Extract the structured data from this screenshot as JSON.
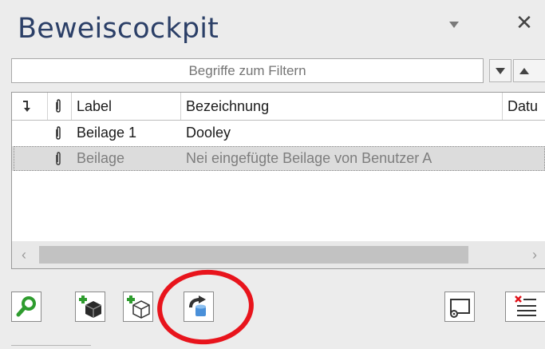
{
  "panel": {
    "title": "Beweiscockpit"
  },
  "header": {
    "menu_icon": "dropdown-triangle-icon",
    "close_glyph": "✕"
  },
  "filter": {
    "placeholder": "Begriffe zum Filtern",
    "value": ""
  },
  "grid": {
    "columns": [
      "",
      "",
      "Label",
      "Bezeichnung",
      "Datu"
    ],
    "rows": [
      {
        "label": "Beilage 1",
        "bezeichnung": "Dooley",
        "selected": false
      },
      {
        "label": "Beilage",
        "bezeichnung": "Nei eingefügte Beilage von Benutzer A",
        "selected": true
      }
    ]
  },
  "scrollbar": {
    "left_arrow": "‹",
    "right_arrow": "›"
  },
  "toolbar": {
    "buttons": [
      "search-icon",
      "add-package-icon",
      "add-empty-package-icon",
      "refresh-object-icon",
      "screen-settings-icon",
      "delete-list-icon"
    ]
  },
  "colors": {
    "title": "#2b3f67",
    "highlight_circle": "#e8141c",
    "search_green": "#2e9c2e"
  }
}
